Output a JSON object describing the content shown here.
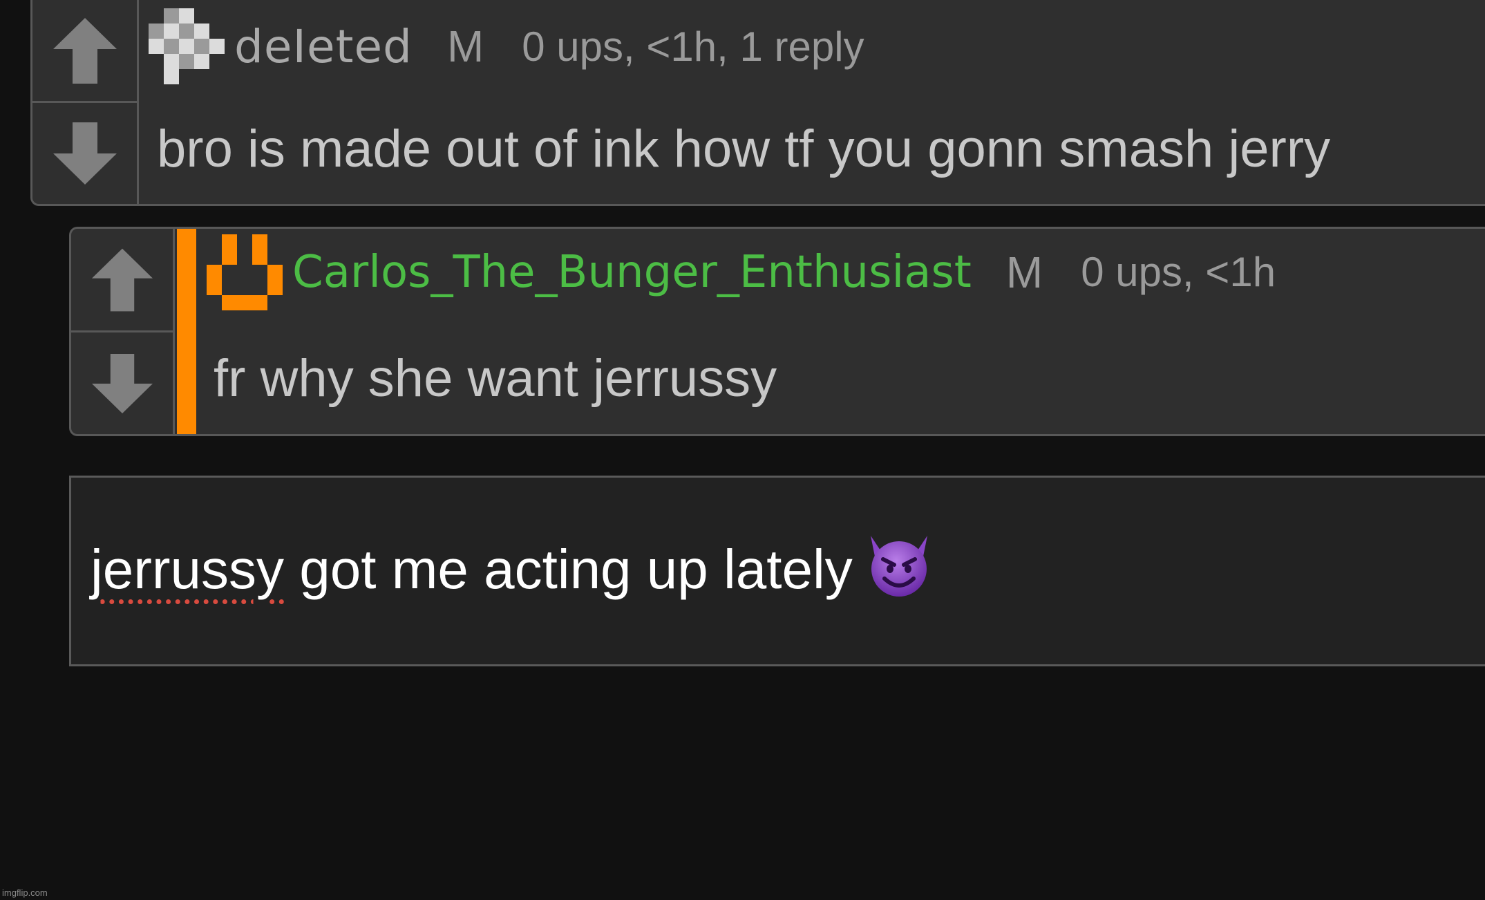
{
  "comments": [
    {
      "username": "deIeted",
      "mod_badge": "M",
      "stats": "0 ups, <1h, 1 reply",
      "body": "bro is made out of ink how tf you gonn smash jerry",
      "avatar": "checker-avatar-icon"
    },
    {
      "username": "Carlos_The_Bunger_Enthusiast",
      "username_color": "#4cbd45",
      "mod_badge": "M",
      "stats": "0 ups, <1h",
      "body": "fr why she want jerrussy",
      "avatar": "orange-smile-avatar-icon",
      "accent_color": "#ff8a00"
    }
  ],
  "reply": {
    "misspelled_word": "jerrussy",
    "rest_text": " got me acting up lately",
    "emoji": "smiling-devil-emoji-icon"
  },
  "watermark": "imgflip.com"
}
